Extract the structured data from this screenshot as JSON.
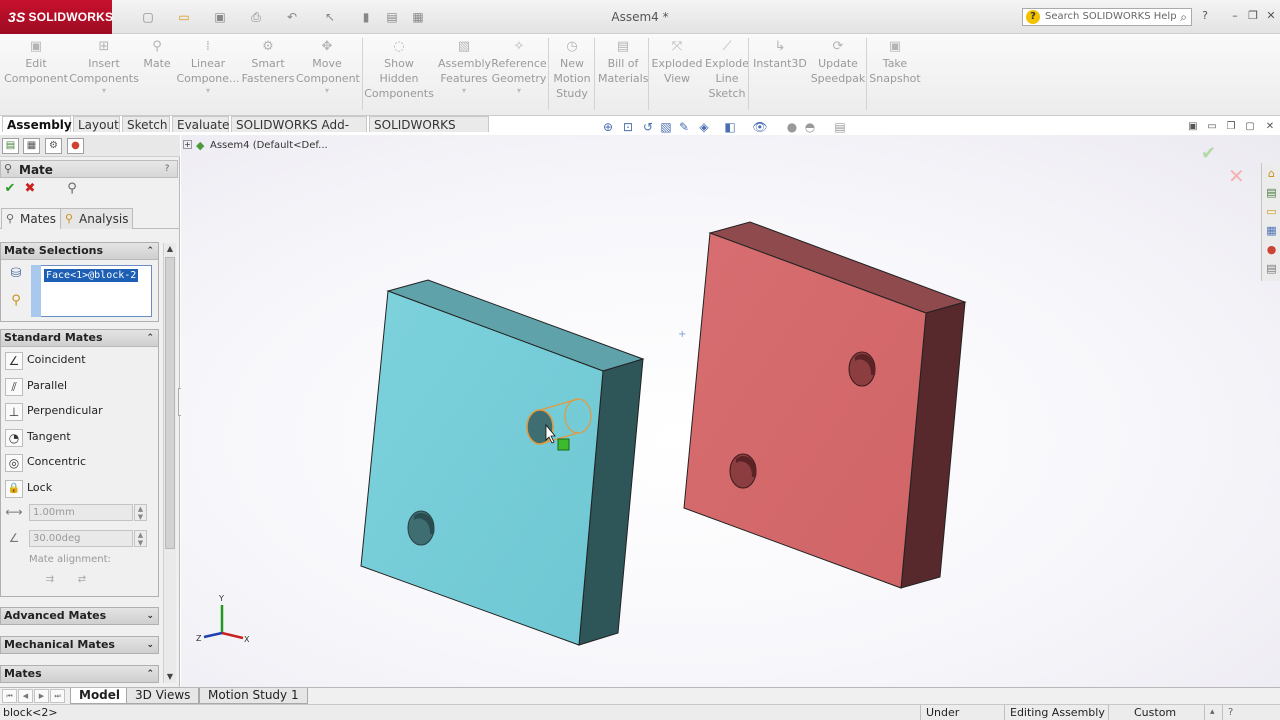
{
  "titlebar": {
    "logo_text": "SOLIDWORKS",
    "logo_mark": "3S",
    "document_title": "Assem4 *",
    "help_search_placeholder": "Search SOLIDWORKS Help",
    "help_icon": "?",
    "search_icon": "⌕"
  },
  "command_manager": {
    "items": [
      {
        "lines": [
          "Edit",
          "Component"
        ],
        "icon": "edit-component-icon"
      },
      {
        "lines": [
          "Insert",
          "Components"
        ],
        "icon": "insert-components-icon",
        "dropdown": true
      },
      {
        "lines": [
          "Mate"
        ],
        "icon": "mate-icon"
      },
      {
        "lines": [
          "Linear",
          "Compone..."
        ],
        "icon": "linear-pattern-icon",
        "dropdown": true
      },
      {
        "lines": [
          "Smart",
          "Fasteners"
        ],
        "icon": "smart-fasteners-icon"
      },
      {
        "lines": [
          "Move",
          "Component"
        ],
        "icon": "move-component-icon",
        "dropdown": true
      },
      {
        "lines": [
          "Show",
          "Hidden",
          "Components"
        ],
        "icon": "show-hidden-icon"
      },
      {
        "lines": [
          "Assembly",
          "Features"
        ],
        "icon": "assembly-features-icon",
        "dropdown": true
      },
      {
        "lines": [
          "Reference",
          "Geometry"
        ],
        "icon": "reference-geometry-icon",
        "dropdown": true
      },
      {
        "lines": [
          "New",
          "Motion",
          "Study"
        ],
        "icon": "motion-study-icon"
      },
      {
        "lines": [
          "Bill of",
          "Materials"
        ],
        "icon": "bill-of-materials-icon"
      },
      {
        "lines": [
          "Exploded",
          "View"
        ],
        "icon": "exploded-view-icon"
      },
      {
        "lines": [
          "Explode",
          "Line",
          "Sketch"
        ],
        "icon": "explode-line-sketch-icon"
      },
      {
        "lines": [
          "Instant3D"
        ],
        "icon": "instant3d-icon"
      },
      {
        "lines": [
          "Update",
          "Speedpak"
        ],
        "icon": "update-speedpak-icon"
      },
      {
        "lines": [
          "Take",
          "Snapshot"
        ],
        "icon": "take-snapshot-icon"
      }
    ],
    "tabs": [
      "Assembly",
      "Layout",
      "Sketch",
      "Evaluate",
      "SOLIDWORKS Add-Ins",
      "SOLIDWORKS MBD"
    ],
    "active_tab": "Assembly"
  },
  "property_manager": {
    "title": "Mate",
    "help": "?",
    "subtabs": [
      "Mates",
      "Analysis"
    ],
    "active_subtab": "Mates",
    "mate_selections": {
      "heading": "Mate Selections",
      "selected_items": [
        "Face<1>@block-2"
      ]
    },
    "standard_mates": {
      "heading": "Standard Mates",
      "items": [
        {
          "label": "Coincident",
          "glyph": "∠"
        },
        {
          "label": "Parallel",
          "glyph": "⫽"
        },
        {
          "label": "Perpendicular",
          "glyph": "⊥"
        },
        {
          "label": "Tangent",
          "glyph": "◔"
        },
        {
          "label": "Concentric",
          "glyph": "◎"
        },
        {
          "label": "Lock",
          "glyph": "🔒"
        }
      ],
      "distance_value": "1.00mm",
      "angle_value": "30.00deg",
      "mate_alignment_label": "Mate alignment:"
    },
    "collapsed_groups": [
      "Advanced Mates",
      "Mechanical Mates",
      "Mates"
    ]
  },
  "viewport": {
    "tree_node_label": "Assem4  (Default<Def...",
    "triad_labels": {
      "x": "X",
      "y": "Y",
      "z": "Z"
    },
    "colors": {
      "block_front": "#76ccd7",
      "block_top": "#5e9ea5",
      "block_side": "#2f5659",
      "block2_front": "#d46a6c",
      "block2_top": "#8e4a4c",
      "block2_side": "#5a2b2e",
      "highlight": "#e39a3c"
    }
  },
  "bottom_tabs": {
    "items": [
      "Model",
      "3D Views",
      "Motion Study 1"
    ],
    "active": "Model"
  },
  "status_bar": {
    "left": "block<2>",
    "state": "Under Defined",
    "mode": "Editing Assembly",
    "units": "Custom"
  }
}
